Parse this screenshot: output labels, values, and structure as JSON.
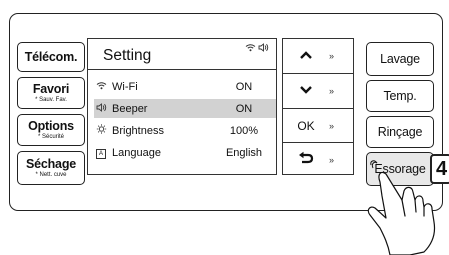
{
  "left_buttons": [
    {
      "main": "Télécom.",
      "sub": ""
    },
    {
      "main": "Favori",
      "sub": "* Sauv. Fav."
    },
    {
      "main": "Options",
      "sub": "* Sécurité"
    },
    {
      "main": "Séchage",
      "sub": "* Nett. cuve"
    }
  ],
  "screen": {
    "title": "Setting",
    "status_icons": [
      "wifi-icon",
      "speaker-icon"
    ],
    "rows": [
      {
        "icon": "wifi-icon",
        "label": "Wi-Fi",
        "value": "ON",
        "selected": false
      },
      {
        "icon": "speaker-icon",
        "label": "Beeper",
        "value": "ON",
        "selected": true
      },
      {
        "icon": "brightness-icon",
        "label": "Brightness",
        "value": "100%",
        "selected": false
      },
      {
        "icon": "language-icon",
        "label": "Language",
        "value": "English",
        "selected": false
      }
    ]
  },
  "nav": {
    "ok_label": "OK",
    "more_glyph": "»",
    "up_icon": "chevron-up-icon",
    "down_icon": "chevron-down-icon",
    "back_icon": "back-arrow-icon"
  },
  "right_buttons": [
    {
      "main": "Lavage"
    },
    {
      "main": "Temp."
    },
    {
      "main": "Rinçage"
    },
    {
      "main": "Essorage"
    }
  ],
  "callout_number": "4"
}
